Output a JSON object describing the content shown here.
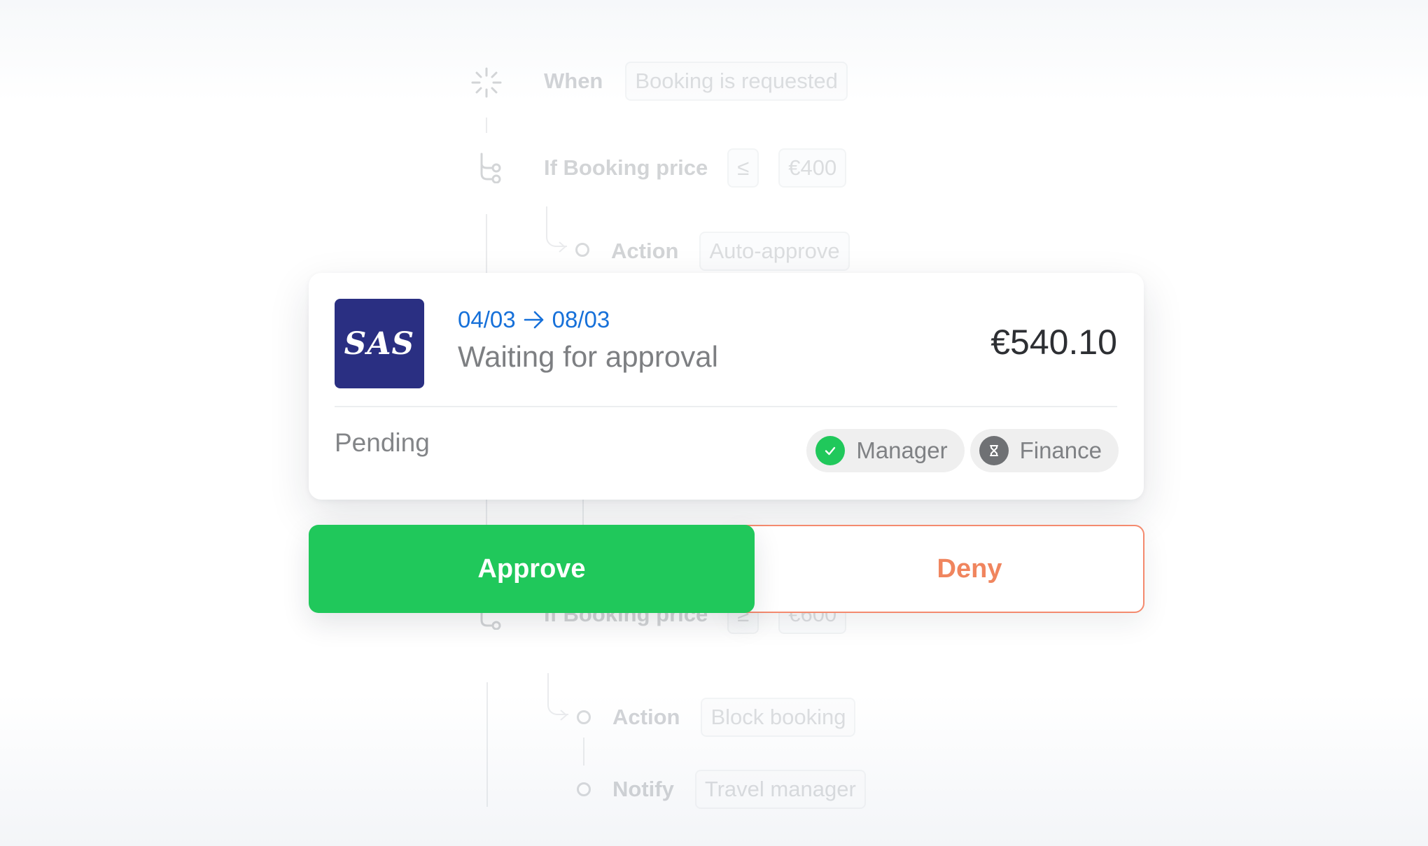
{
  "workflow": {
    "trigger": {
      "label": "When",
      "value": "Booking is requested",
      "icon": "sparkle-icon"
    },
    "condition1": {
      "label": "If Booking price",
      "operator": "≤",
      "value": "€400",
      "icon": "branch-icon"
    },
    "action1": {
      "label": "Action",
      "value": "Auto-approve"
    },
    "condition2": {
      "label": "If Booking price",
      "operator": "≥",
      "value": "€600",
      "icon": "branch-icon"
    },
    "action2": {
      "label": "Action",
      "value": "Block booking"
    },
    "notify": {
      "label": "Notify",
      "value": "Travel manager"
    }
  },
  "booking": {
    "airline_logo_text": "SAS",
    "date_from": "04/03",
    "date_to": "08/03",
    "status_title": "Waiting for approval",
    "price": "€540.10",
    "approval_state": "Pending",
    "approvers": [
      {
        "name": "Manager",
        "status": "approved",
        "icon": "checkmark-icon",
        "color": "#20c85b"
      },
      {
        "name": "Finance",
        "status": "waiting",
        "icon": "hourglass-icon",
        "color": "#6f7174"
      }
    ]
  },
  "actions": {
    "approve_label": "Approve",
    "deny_label": "Deny"
  },
  "colors": {
    "approve": "#20c85b",
    "deny": "#f0855e",
    "date_blue": "#1670d9",
    "logo_bg": "#2a2f82"
  }
}
